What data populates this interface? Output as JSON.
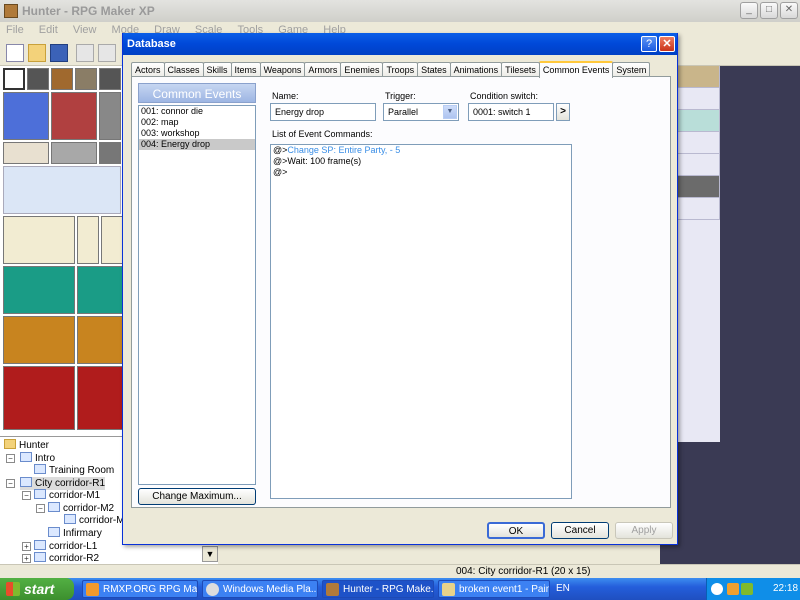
{
  "main_window": {
    "title": "Hunter - RPG Maker XP",
    "menus": [
      "File",
      "Edit",
      "View",
      "Mode",
      "Draw",
      "Scale",
      "Tools",
      "Game",
      "Help"
    ]
  },
  "map_tree": {
    "items": [
      {
        "label": "Hunter"
      },
      {
        "label": "Intro"
      },
      {
        "label": "Training Room"
      },
      {
        "label": "City corridor-R1"
      },
      {
        "label": "corridor-M1"
      },
      {
        "label": "corridor-M2"
      },
      {
        "label": "corridor-M3"
      },
      {
        "label": "Infirmary"
      },
      {
        "label": "corridor-L1"
      },
      {
        "label": "corridor-R2"
      }
    ]
  },
  "statusbar": {
    "text": "004: City corridor-R1 (20 x 15)"
  },
  "dialog": {
    "title": "Database",
    "help": "?",
    "close": "✕",
    "tabs": [
      "Actors",
      "Classes",
      "Skills",
      "Items",
      "Weapons",
      "Armors",
      "Enemies",
      "Troops",
      "States",
      "Animations",
      "Tilesets",
      "Common Events",
      "System"
    ],
    "active_tab": "Common Events",
    "list_header": "Common Events",
    "list_items": [
      "001: connor die",
      "002: map",
      "003: workshop",
      "004: Energy drop"
    ],
    "selected_item": "004: Energy drop",
    "change_max": "Change Maximum...",
    "name_label": "Name:",
    "name_value": "Energy drop",
    "trigger_label": "Trigger:",
    "trigger_value": "Parallel",
    "cond_label": "Condition switch:",
    "cond_value": "0001: switch 1",
    "cond_arrow": ">",
    "list_label": "List of Event Commands:",
    "commands": [
      {
        "prefix": "@>",
        "text": "Change SP: Entire Party, - 5",
        "color": "#3a8ee6"
      },
      {
        "prefix": "@>",
        "text": "Wait: 100 frame(s)",
        "color": "#000000"
      },
      {
        "prefix": "@>",
        "text": "",
        "color": "#000000"
      }
    ],
    "ok": "OK",
    "cancel": "Cancel",
    "apply": "Apply"
  },
  "taskbar": {
    "start": "start",
    "tasks": [
      {
        "label": "RMXP.ORG RPG Ma..."
      },
      {
        "label": "Windows Media Pla..."
      },
      {
        "label": "Hunter - RPG Make..."
      },
      {
        "label": "broken event1 - Paint"
      }
    ],
    "lang": "EN",
    "time": "22:18"
  }
}
